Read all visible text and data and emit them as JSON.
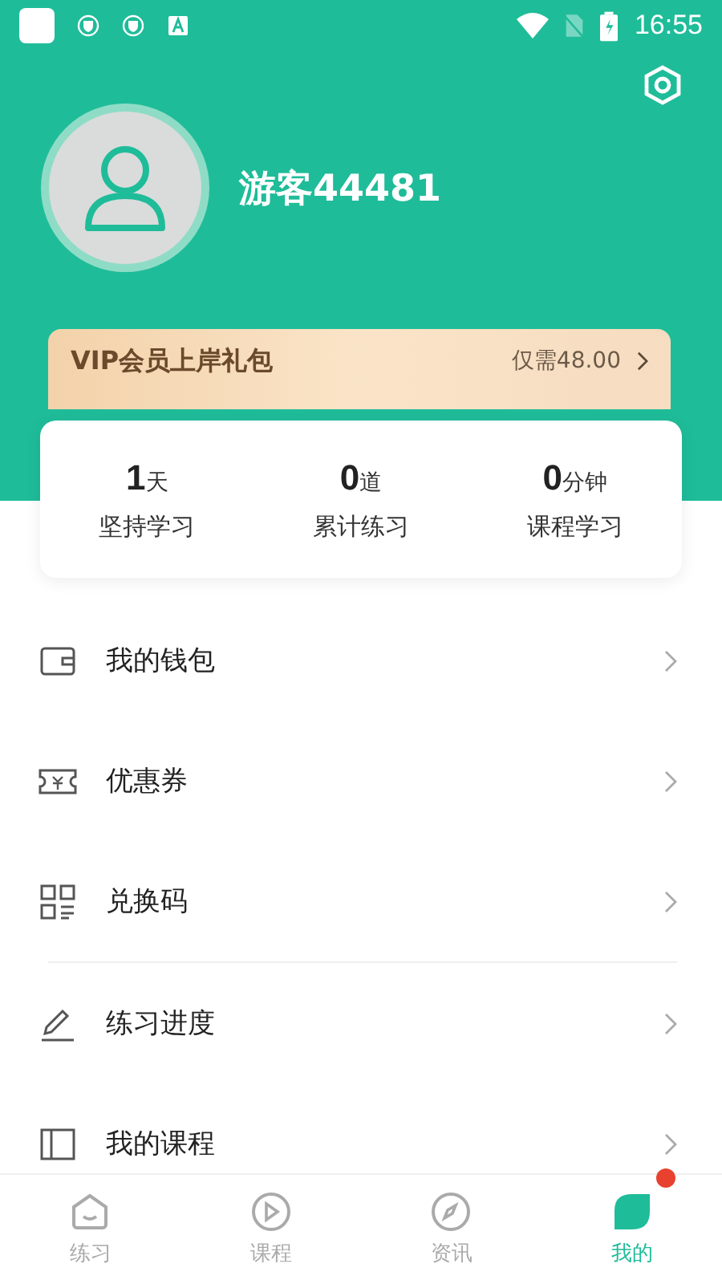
{
  "status_bar": {
    "time": "16:55"
  },
  "profile": {
    "name": "游客44481"
  },
  "vip_banner": {
    "title": "VIP会员上岸礼包",
    "price": "仅需48.00"
  },
  "stats": [
    {
      "value": "1",
      "unit": "天",
      "label": "坚持学习"
    },
    {
      "value": "0",
      "unit": "道",
      "label": "累计练习"
    },
    {
      "value": "0",
      "unit": "分钟",
      "label": "课程学习"
    }
  ],
  "menu_groups": [
    {
      "items": [
        {
          "kind": "wallet",
          "label": "我的钱包"
        },
        {
          "kind": "ticket",
          "label": "优惠券"
        },
        {
          "kind": "code",
          "label": "兑换码"
        }
      ]
    },
    {
      "items": [
        {
          "kind": "pencil",
          "label": "练习进度"
        },
        {
          "kind": "book",
          "label": "我的课程"
        }
      ]
    }
  ],
  "tabs": [
    {
      "kind": "home",
      "label": "练习",
      "selected": false,
      "badge": false
    },
    {
      "kind": "play",
      "label": "课程",
      "selected": false,
      "badge": false
    },
    {
      "kind": "news",
      "label": "资讯",
      "selected": false,
      "badge": false
    },
    {
      "kind": "me",
      "label": "我的",
      "selected": true,
      "badge": true
    }
  ]
}
